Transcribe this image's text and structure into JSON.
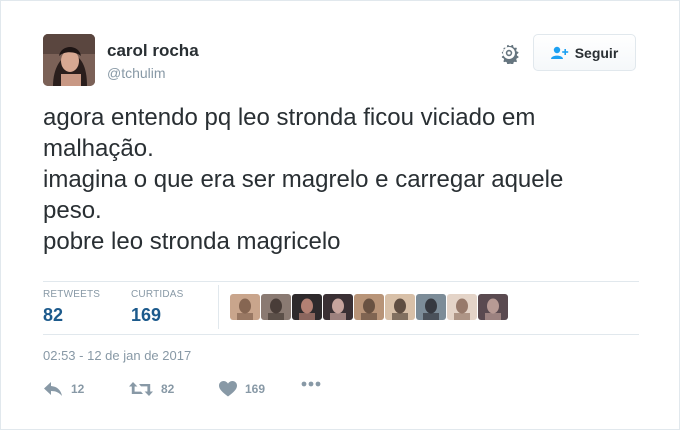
{
  "user": {
    "name": "carol rocha",
    "handle": "@tchulim"
  },
  "header": {
    "follow_label": "Seguir",
    "settings_icon": "gear-icon",
    "follow_icon": "add-user-icon"
  },
  "tweet": {
    "lines": [
      "agora entendo pq leo stronda ficou viciado em",
      "malhação.",
      "imagina o que era ser magrelo e carregar aquele",
      "peso.",
      "pobre leo stronda magricelo"
    ]
  },
  "stats": {
    "retweets_label": "RETWEETS",
    "retweets_value": "82",
    "likes_label": "CURTIDAS",
    "likes_value": "169",
    "liker_avatars": [
      {
        "color": "#c9a58c",
        "accent": "#7a5a48"
      },
      {
        "color": "#8a7a72",
        "accent": "#3d332e"
      },
      {
        "color": "#2e2a2c",
        "accent": "#c98f80"
      },
      {
        "color": "#3a3034",
        "accent": "#e0b8b0"
      },
      {
        "color": "#b89478",
        "accent": "#5a4638"
      },
      {
        "color": "#d8c0a8",
        "accent": "#4a3a30"
      },
      {
        "color": "#7c8c98",
        "accent": "#2a2a30"
      },
      {
        "color": "#e4d4c8",
        "accent": "#8a6a5a"
      },
      {
        "color": "#5a4a50",
        "accent": "#c8a8a0"
      }
    ]
  },
  "timestamp": "02:53 - 12 de jan de 2017",
  "actions": {
    "reply_count": "12",
    "retweet_count": "82",
    "like_count": "169",
    "reply_icon": "reply-icon",
    "retweet_icon": "retweet-icon",
    "like_icon": "heart-icon",
    "more_icon": "more-icon"
  },
  "colors": {
    "text": "#292f33",
    "muted": "#8899a6",
    "stat_value": "#1c5a8c",
    "border": "#e1e8ed"
  }
}
